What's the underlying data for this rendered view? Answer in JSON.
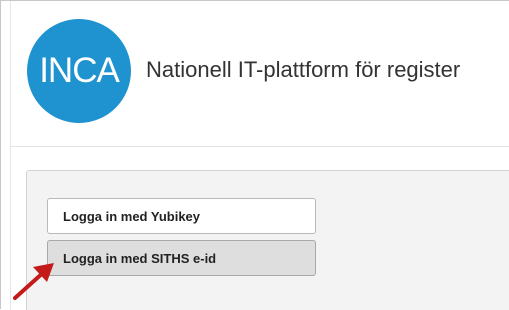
{
  "logo": {
    "text": "INCA",
    "color": "#1f93cf"
  },
  "header": {
    "title": "Nationell IT-plattform för register"
  },
  "login": {
    "yubikey_label": "Logga in med Yubikey",
    "siths_label": "Logga in med SITHS e-id"
  },
  "annotation": {
    "arrow_color": "#c41a1a",
    "arrow_icon": "red-arrow-icon"
  }
}
